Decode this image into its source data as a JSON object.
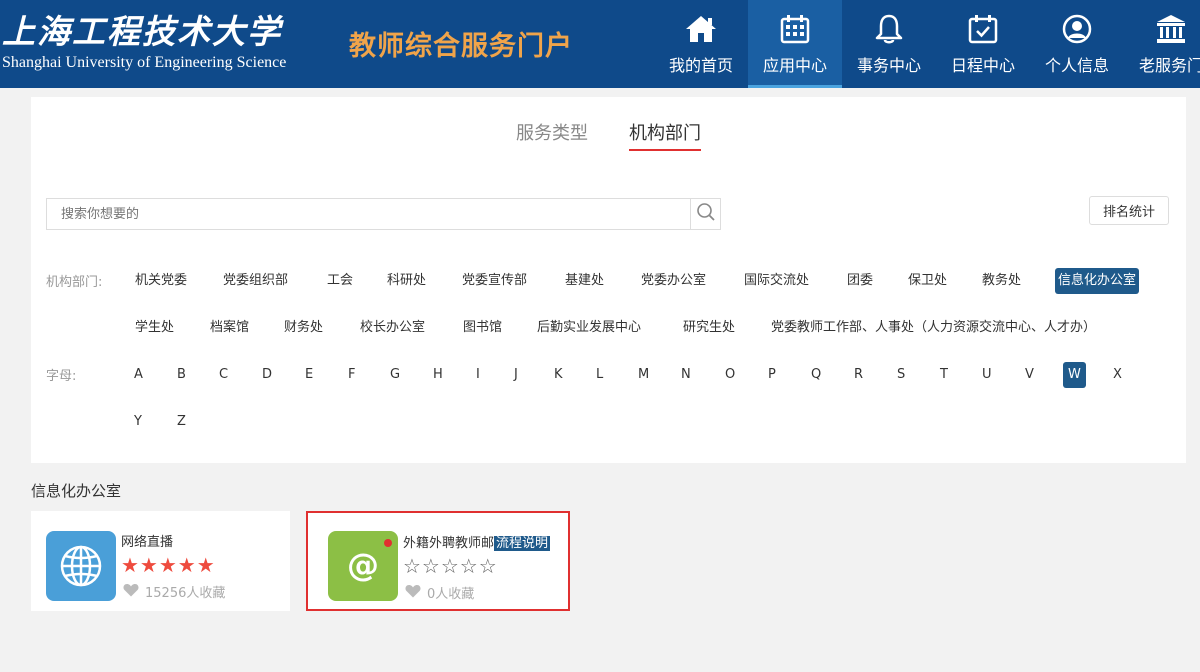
{
  "header": {
    "logo_cn": "上海工程技术大学",
    "logo_en": "Shanghai University of Engineering Science",
    "portal_title": "教师综合服务门户",
    "nav": [
      {
        "label": "我的首页",
        "icon": "home-icon"
      },
      {
        "label": "应用中心",
        "icon": "calendar-grid-icon",
        "active": true
      },
      {
        "label": "事务中心",
        "icon": "bell-icon"
      },
      {
        "label": "日程中心",
        "icon": "calendar-check-icon"
      },
      {
        "label": "个人信息",
        "icon": "user-circle-icon"
      },
      {
        "label": "老服务门",
        "icon": "bank-icon"
      }
    ]
  },
  "filter": {
    "tabs": [
      {
        "label": "服务类型"
      },
      {
        "label": "机构部门",
        "active": true
      }
    ],
    "search_placeholder": "搜索你想要的",
    "rank_button": "排名统计",
    "dept_label": "机构部门:",
    "letter_label": "字母:",
    "departments": [
      "机关党委",
      "党委组织部",
      "工会",
      "科研处",
      "党委宣传部",
      "基建处",
      "党委办公室",
      "国际交流处",
      "团委",
      "保卫处",
      "教务处",
      "信息化办公室",
      "学生处",
      "档案馆",
      "财务处",
      "校长办公室",
      "图书馆",
      "后勤实业发展中心",
      "研究生处",
      "党委教师工作部、人事处（人力资源交流中心、人才办）"
    ],
    "active_department": "信息化办公室",
    "letters": [
      "A",
      "B",
      "C",
      "D",
      "E",
      "F",
      "G",
      "H",
      "I",
      "J",
      "K",
      "L",
      "M",
      "N",
      "O",
      "P",
      "Q",
      "R",
      "S",
      "T",
      "U",
      "V",
      "W",
      "X",
      "Y",
      "Z"
    ],
    "active_letter": "W"
  },
  "results": {
    "section_title": "信息化办公室",
    "cards": [
      {
        "name": "网络直播",
        "stars": "★★★★★",
        "fav": "15256人收藏",
        "icon": "globe-icon",
        "icon_color": "#4a9fd8",
        "star_color": "#ee4b3e"
      },
      {
        "name": "外籍外聘教师邮",
        "badge": "流程说明",
        "stars": "☆☆☆☆☆",
        "fav": "0人收藏",
        "icon": "at-sign-icon",
        "icon_color": "#8cbf45",
        "star_color": "#666666",
        "new": true
      }
    ]
  }
}
